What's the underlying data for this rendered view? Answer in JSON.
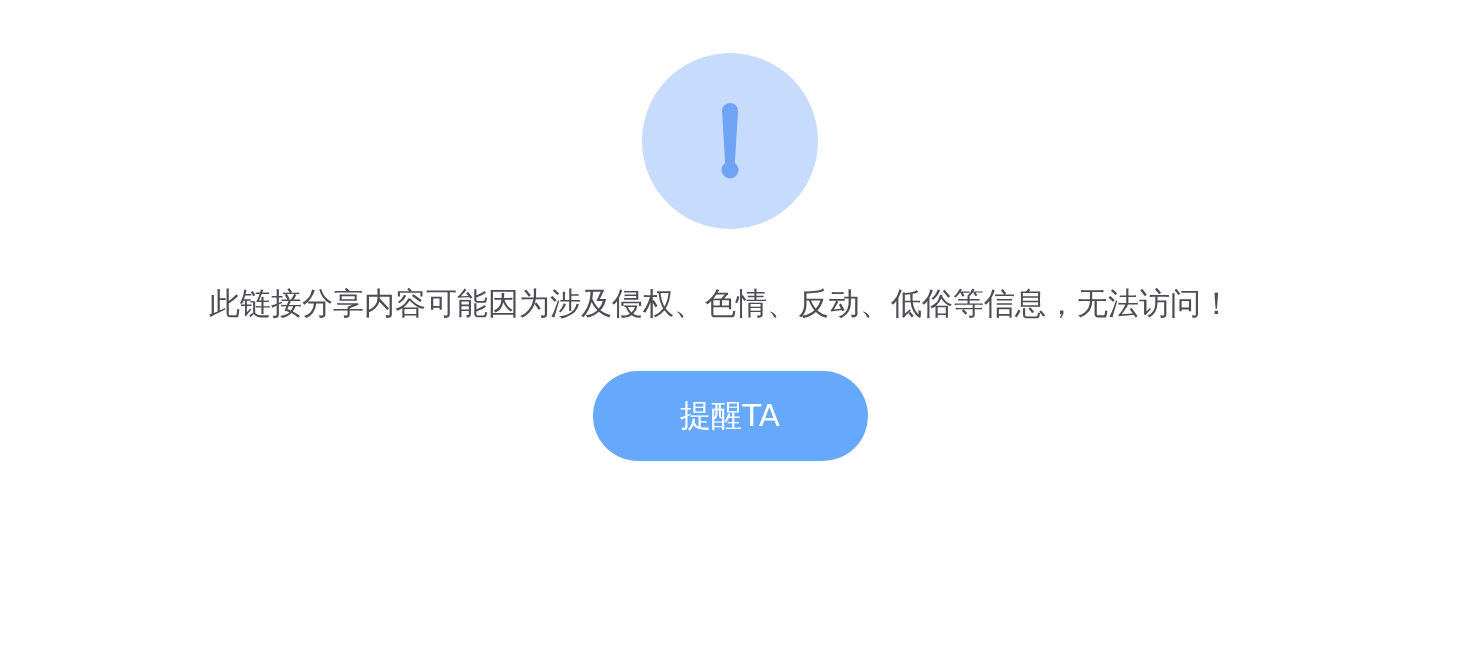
{
  "message": "此链接分享内容可能因为涉及侵权、色情、反动、低俗等信息，无法访问！",
  "button": {
    "label": "提醒TA"
  }
}
